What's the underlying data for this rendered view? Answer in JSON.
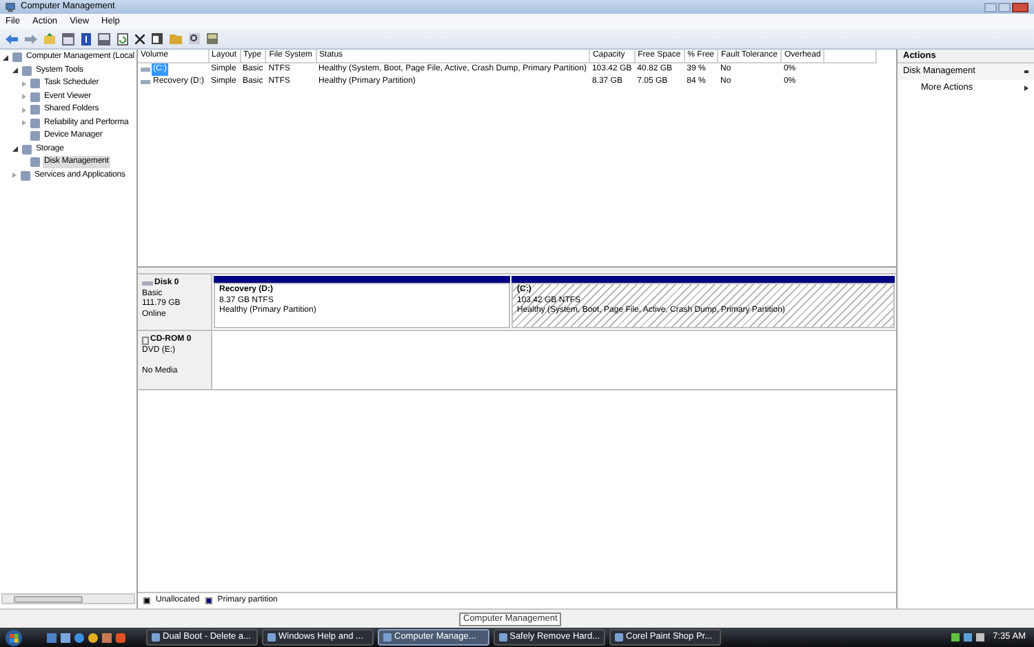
{
  "window": {
    "title": "Computer Management"
  },
  "menu": [
    "File",
    "Action",
    "View",
    "Help"
  ],
  "tree": [
    {
      "label": "Computer Management (Local",
      "expanded": true,
      "selected": false,
      "children": [
        {
          "label": "System Tools",
          "expanded": true,
          "selected": false,
          "children": [
            {
              "label": "Task Scheduler",
              "expanded": false,
              "selected": false
            },
            {
              "label": "Event Viewer",
              "expanded": false,
              "selected": false
            },
            {
              "label": "Shared Folders",
              "expanded": false,
              "selected": false
            },
            {
              "label": "Reliability and Performa",
              "expanded": false,
              "selected": false
            },
            {
              "label": "Device Manager",
              "selected": false
            }
          ]
        },
        {
          "label": "Storage",
          "expanded": true,
          "selected": false,
          "children": [
            {
              "label": "Disk Management",
              "selected": true
            }
          ]
        },
        {
          "label": "Services and Applications",
          "expanded": false,
          "selected": false
        }
      ]
    }
  ],
  "table": {
    "columns": [
      "Volume",
      "Layout",
      "Type",
      "File System",
      "Status",
      "Capacity",
      "Free Space",
      "% Free",
      "Fault Tolerance",
      "Overhead"
    ],
    "rows": [
      {
        "selected": true,
        "cells": [
          "(C:)",
          "Simple",
          "Basic",
          "NTFS",
          "Healthy (System, Boot, Page File, Active, Crash Dump, Primary Partition)",
          "103.42 GB",
          "40.82 GB",
          "39 %",
          "No",
          "0%"
        ]
      },
      {
        "selected": false,
        "cells": [
          "Recovery (D:)",
          "Simple",
          "Basic",
          "NTFS",
          "Healthy (Primary Partition)",
          "8.37 GB",
          "7.05 GB",
          "84 %",
          "No",
          "0%"
        ]
      }
    ]
  },
  "disks": [
    {
      "kind": "disk",
      "name": "Disk 0",
      "lines": [
        "Basic",
        "111.79 GB",
        "Online"
      ],
      "partitions": [
        {
          "name": "Recovery  (D:)",
          "size": "8.37 GB NTFS",
          "status": "Healthy (Primary Partition)",
          "selected": false
        },
        {
          "name": "(C:)",
          "size": "103.42 GB NTFS",
          "status": "Healthy (System, Boot, Page File, Active, Crash Dump, Primary Partition)",
          "selected": true
        }
      ]
    },
    {
      "kind": "cdrom",
      "name": "CD-ROM 0",
      "lines": [
        "DVD (E:)",
        "No Media"
      ]
    }
  ],
  "legend": [
    {
      "label": "Unallocated",
      "color": "#000000"
    },
    {
      "label": "Primary partition",
      "color": "#000080"
    }
  ],
  "actions": {
    "header": "Actions",
    "section": "Disk Management",
    "items": [
      "More Actions"
    ]
  },
  "status_tooltip": "Computer Management",
  "taskbar": {
    "tasks": [
      {
        "label": "Dual Boot - Delete a...",
        "selected": false
      },
      {
        "label": "Windows Help and ...",
        "selected": false
      },
      {
        "label": "Computer Manage...",
        "selected": true
      },
      {
        "label": "Safely Remove Hard...",
        "selected": false
      },
      {
        "label": "Corel Paint Shop Pr...",
        "selected": false
      }
    ],
    "clock": "7:35 AM"
  }
}
